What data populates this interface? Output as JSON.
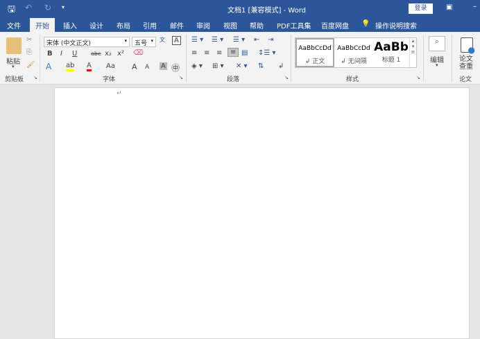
{
  "title": "文档1 [兼容模式] - Word",
  "login": "登录",
  "tabs": [
    "文件",
    "开始",
    "插入",
    "设计",
    "布局",
    "引用",
    "邮件",
    "审阅",
    "视图",
    "帮助",
    "PDF工具集",
    "百度网盘",
    "操作说明搜索"
  ],
  "clipboard": {
    "paste": "粘贴",
    "label": "剪贴板"
  },
  "font": {
    "name": "宋体 (中文正文)",
    "size": "五号",
    "label": "字体",
    "bold": "B",
    "italic": "I",
    "underline": "U",
    "strike": "abc",
    "sub": "x₂",
    "sup": "x²",
    "case": "Aa",
    "grow": "A",
    "shrink": "A"
  },
  "paragraph": {
    "label": "段落"
  },
  "styles": {
    "label": "样式",
    "items": [
      {
        "preview": "AaBbCcDd",
        "name": "↲ 正文"
      },
      {
        "preview": "AaBbCcDd",
        "name": "↲ 无间隔"
      },
      {
        "preview": "AaBb",
        "name": "标题 1"
      }
    ]
  },
  "editing": {
    "label": "编辑"
  },
  "thesis": {
    "btn": "论文\n查重",
    "label": "论文"
  },
  "colors": {
    "accent": "#2b579a",
    "highlight": "#ffff00",
    "fontcolor": "#ff0000"
  }
}
